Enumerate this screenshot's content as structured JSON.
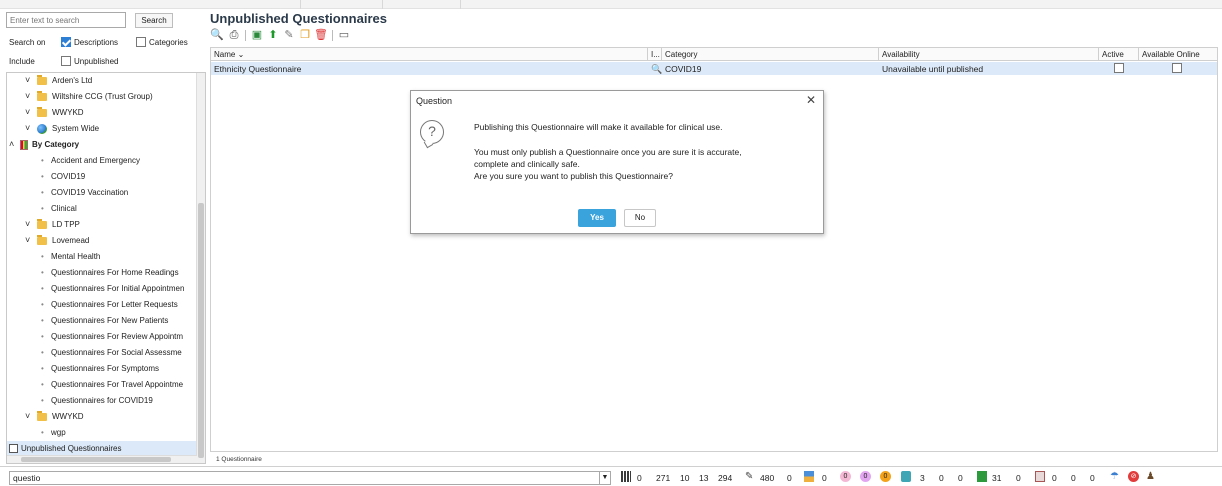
{
  "left_panel": {
    "search": {
      "placeholder": "Enter text to search",
      "button": "Search"
    },
    "search_on": {
      "label": "Search on",
      "descriptions": "Descriptions",
      "descriptions_checked": true,
      "categories": "Categories",
      "categories_checked": false
    },
    "include": {
      "label": "Include",
      "unpublished": "Unpublished",
      "unpublished_checked": false
    },
    "tree": [
      {
        "label": "Arden's Ltd",
        "kind": "folder",
        "level": 1,
        "expanded": true
      },
      {
        "label": "Wiltshire CCG (Trust Group)",
        "kind": "folder",
        "level": 1,
        "expanded": true
      },
      {
        "label": "WWYKD",
        "kind": "folder",
        "level": 1,
        "expanded": true
      },
      {
        "label": "System Wide",
        "kind": "globe",
        "level": 1,
        "expanded": true
      },
      {
        "label": "By Category",
        "kind": "category",
        "level": 0,
        "expanded": true
      },
      {
        "label": "Accident and Emergency",
        "kind": "leaf",
        "level": 2
      },
      {
        "label": "COVID19",
        "kind": "leaf",
        "level": 2
      },
      {
        "label": "COVID19 Vaccination",
        "kind": "leaf",
        "level": 2
      },
      {
        "label": "Clinical",
        "kind": "leaf",
        "level": 2
      },
      {
        "label": "LD TPP",
        "kind": "folder",
        "level": 1,
        "expanded": true
      },
      {
        "label": "Lovemead",
        "kind": "folder",
        "level": 1,
        "expanded": true
      },
      {
        "label": "Mental Health",
        "kind": "leaf",
        "level": 2
      },
      {
        "label": "Questionnaires For Home Readings",
        "kind": "leaf",
        "level": 2
      },
      {
        "label": "Questionnaires For Initial Appointmen",
        "kind": "leaf",
        "level": 2
      },
      {
        "label": "Questionnaires For Letter Requests",
        "kind": "leaf",
        "level": 2
      },
      {
        "label": "Questionnaires For New Patients",
        "kind": "leaf",
        "level": 2
      },
      {
        "label": "Questionnaires For Review Appointm",
        "kind": "leaf",
        "level": 2
      },
      {
        "label": "Questionnaires For Social Assessme",
        "kind": "leaf",
        "level": 2
      },
      {
        "label": "Questionnaires For Symptoms",
        "kind": "leaf",
        "level": 2
      },
      {
        "label": "Questionnaires For Travel Appointme",
        "kind": "leaf",
        "level": 2
      },
      {
        "label": "Questionnaires for COVID19",
        "kind": "leaf",
        "level": 2
      },
      {
        "label": "WWYKD",
        "kind": "folder",
        "level": 1,
        "expanded": true
      },
      {
        "label": "wgp",
        "kind": "leaf",
        "level": 2
      },
      {
        "label": "Unpublished Questionnaires",
        "kind": "unpublished",
        "level": 0,
        "selected": true
      }
    ]
  },
  "main": {
    "title": "Unpublished Questionnaires",
    "toolbar_icons": [
      "search-icon",
      "print-icon",
      "view-icon",
      "publish-icon",
      "edit-icon",
      "copy-icon",
      "delete-icon",
      "window-icon"
    ],
    "columns": {
      "name": "Name",
      "info": "I...",
      "category": "Category",
      "availability": "Availability",
      "active": "Active",
      "available_online": "Available Online"
    },
    "rows": [
      {
        "name": "Ethnicity Questionnaire",
        "category": "COVID19",
        "availability": "Unavailable until published",
        "active": false,
        "available_online": false
      }
    ],
    "footer": "1 Questionnaire"
  },
  "dialog": {
    "title": "Question",
    "line1": "Publishing this Questionnaire will make it available for clinical use.",
    "line2": "You must only publish a Questionnaire once you are sure it is accurate,",
    "line3": "complete and clinically safe.",
    "line4": "Are you sure you want to publish this Questionnaire?",
    "yes": "Yes",
    "no": "No"
  },
  "status_bar": {
    "input_value": "questio",
    "values": {
      "a": "0",
      "b": "271",
      "c": "10",
      "d": "13",
      "e": "294",
      "f": "480",
      "g": "0",
      "h": "0",
      "i": "0",
      "j": "0",
      "k": "0",
      "l": "3",
      "m": "0",
      "n": "0",
      "o": "31",
      "p": "0",
      "q": "0",
      "r": "0",
      "s": "0"
    }
  }
}
